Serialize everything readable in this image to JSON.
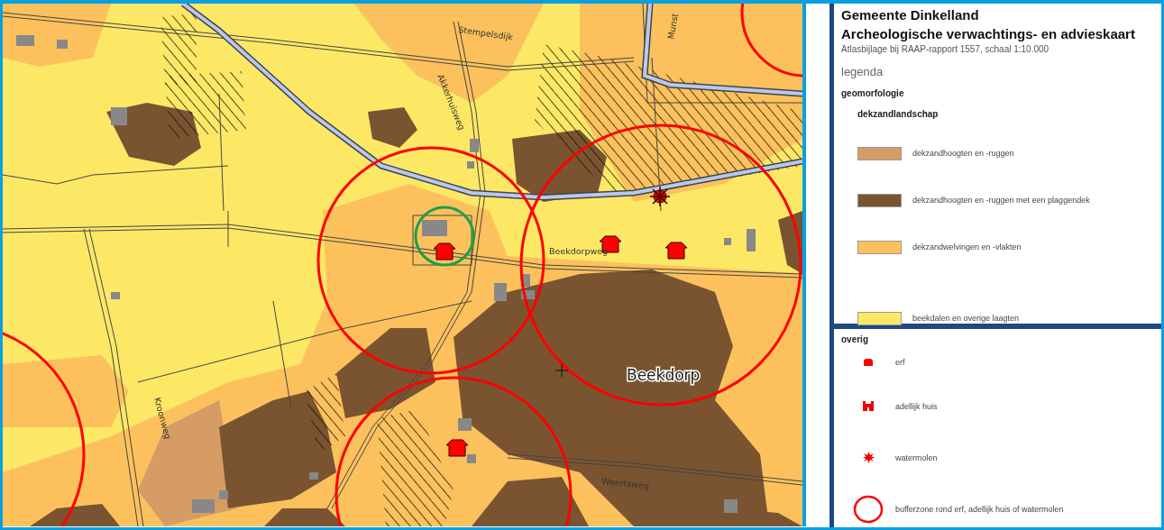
{
  "map": {
    "labels": [
      {
        "text": "Stempelsdijk",
        "kind": "street"
      },
      {
        "text": "Akkerhuisweg",
        "kind": "street"
      },
      {
        "text": "Munst",
        "kind": "street"
      },
      {
        "text": "Beekdorpweg",
        "kind": "street"
      },
      {
        "text": "Kroonweg",
        "kind": "street"
      },
      {
        "text": "Weertsweg",
        "kind": "street"
      },
      {
        "text": "Beekdorp",
        "kind": "place"
      }
    ]
  },
  "legend": {
    "title": "Gemeente Dinkelland",
    "subtitle": "Archeologische verwachtings- en advieskaart",
    "caption": "Atlasbijlage bij RAAP-rapport 1557, schaal 1:10.000",
    "heading": "legenda",
    "section": "geomorfologie",
    "subsection": "dekzandlandschap",
    "items": [
      {
        "label": "dekzandhoogten en -ruggen",
        "color": "#d69c66"
      },
      {
        "label": "dekzandhoogten en -ruggen met een plaggendek",
        "color": "#7a5430"
      },
      {
        "label": "dekzandwelvingen en -vlakten",
        "color": "#fcc15c"
      },
      {
        "label": "beekdalen en overige laagten",
        "color": "#fde866"
      }
    ]
  },
  "other": {
    "heading": "overig",
    "items": [
      {
        "kind": "erf",
        "label": "erf"
      },
      {
        "kind": "adellijk",
        "label": "adellijk huis"
      },
      {
        "kind": "watermolen",
        "label": "watermolen"
      },
      {
        "kind": "buffer",
        "label": "bufferzone rond erf, adellijk huis of watermolen"
      }
    ]
  }
}
